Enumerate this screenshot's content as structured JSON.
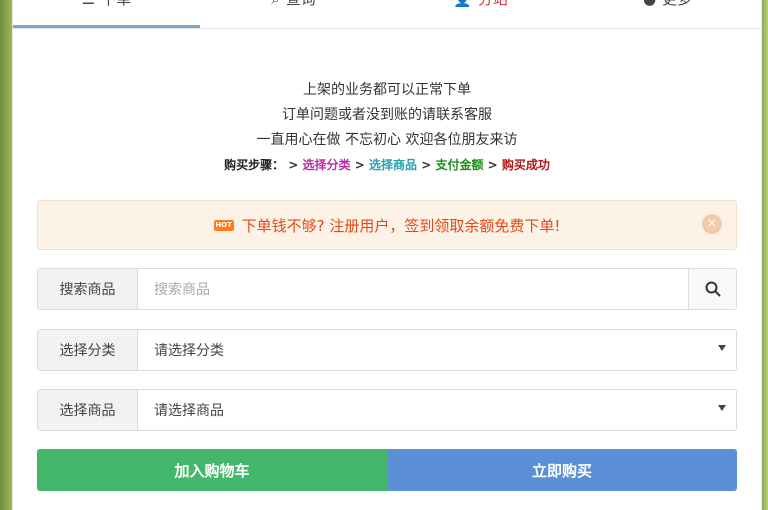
{
  "tabs": [
    {
      "label": "下单",
      "icon": "list-icon"
    },
    {
      "label": "查询",
      "icon": "search-icon"
    },
    {
      "label": "分站",
      "icon": "user-icon"
    },
    {
      "label": "更多",
      "icon": "more-icon"
    }
  ],
  "notice": {
    "line1": "上架的业务都可以正常下单",
    "line2": "订单问题或者没到账的请联系客服",
    "line3": "一直用心在做 不忘初心 欢迎各位朋友来访",
    "steps_label": "购买步骤：",
    "step1": "选择分类",
    "step2": "选择商品",
    "step3": "支付金额",
    "step4": "购买成功",
    "arrow": ">"
  },
  "alert": {
    "badge": "HOT",
    "text": "下单钱不够? 注册用户，签到领取余额免费下单!",
    "close": "×"
  },
  "search": {
    "label": "搜索商品",
    "placeholder": "搜索商品"
  },
  "category": {
    "label": "选择分类",
    "value": "请选择分类"
  },
  "product": {
    "label": "选择商品",
    "value": "请选择商品"
  },
  "actions": {
    "add_to_cart": "加入购物车",
    "buy_now": "立即购买"
  },
  "colors": {
    "green": "#44b86a",
    "blue": "#5b8fd6",
    "alert_text": "#e34a1a"
  }
}
